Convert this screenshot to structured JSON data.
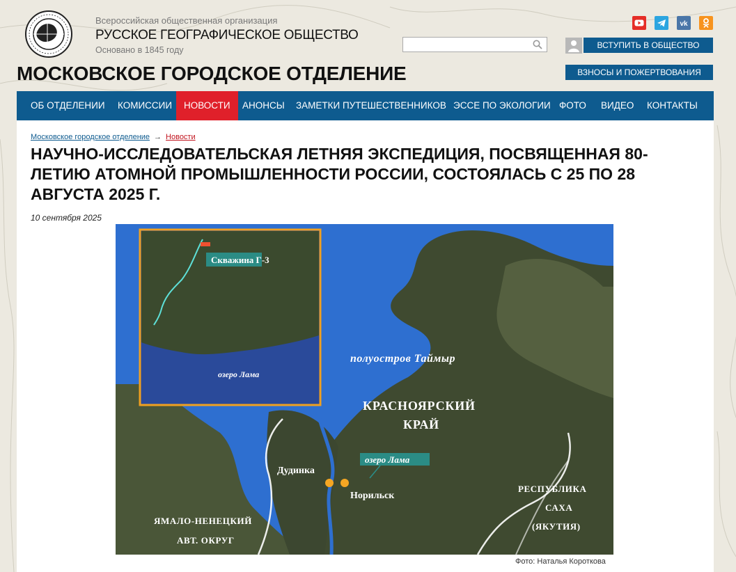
{
  "header": {
    "org_subtitle": "Всероссийская общественная организация",
    "org_name": "РУССКОЕ ГЕОГРАФИЧЕСКОЕ ОБЩЕСТВО",
    "org_founded": "Основано в 1845 году",
    "branch_title": "МОСКОВСКОЕ ГОРОДСКОЕ ОТДЕЛЕНИЕ",
    "logo_text": "РУССКОЕ ГЕОГРАФИЧЕСКОЕ ОБЩЕСТВО • ОСНОВАНО В 1845 Г.",
    "join_button": "ВСТУПИТЬ В ОБЩЕСТВО",
    "donate_button": "ВЗНОСЫ И ПОЖЕРТВОВАНИЯ",
    "search": {
      "value": "",
      "placeholder": ""
    },
    "social": [
      {
        "icon": "youtube-icon",
        "color": "#e52d27"
      },
      {
        "icon": "telegram-icon",
        "color": "#2ca5e0"
      },
      {
        "icon": "vk-icon",
        "color": "#4a76a8"
      },
      {
        "icon": "odnoklassniki-icon",
        "color": "#f7931e"
      }
    ]
  },
  "nav": {
    "items": [
      {
        "label": "ОБ ОТДЕЛЕНИИ",
        "active": false
      },
      {
        "label": "КОМИССИИ",
        "active": false
      },
      {
        "label": "НОВОСТИ",
        "active": true
      },
      {
        "label": "АНОНСЫ",
        "active": false
      },
      {
        "label": "ЗАМЕТКИ ПУТЕШЕСТВЕННИКОВ",
        "active": false
      },
      {
        "label": "ЭССЕ ПО ЭКОЛОГИИ",
        "active": false
      },
      {
        "label": "ФОТО",
        "active": false
      },
      {
        "label": "ВИДЕО",
        "active": false
      },
      {
        "label": "КОНТАКТЫ",
        "active": false
      }
    ]
  },
  "breadcrumb": {
    "home": "Московское городское отделение",
    "current": "Новости"
  },
  "article": {
    "title": "НАУЧНО-ИССЛЕДОВАТЕЛЬСКАЯ ЛЕТНЯЯ ЭКСПЕДИЦИЯ, ПОСВЯЩЕННАЯ 80-ЛЕТИЮ АТОМНОЙ ПРОМЫШЛЕННОСТИ РОССИИ, СОСТОЯЛАСЬ С 25 ПО 28 АВГУСТА 2025 Г.",
    "date": "10 сентября 2025",
    "photo_caption": "Фото: Наталья Короткова",
    "map_labels": {
      "well": "Скважина Г-3",
      "lake_inset": "озеро Лама",
      "peninsula": "полуостров Таймыр",
      "krai_line1": "КРАСНОЯРСКИЙ",
      "krai_line2": "КРАЙ",
      "lake_main": "озеро Лама",
      "dudinka": "Дудинка",
      "norilsk": "Норильск",
      "sakha_line1": "РЕСПУБЛИКА",
      "sakha_line2": "САХА",
      "sakha_line3": "(ЯКУТИЯ)",
      "yamal_line1": "ЯМАЛО-НЕНЕЦКИЙ",
      "yamal_line2": "АВТ. ОКРУГ"
    }
  },
  "colors": {
    "brand_blue": "#0e5b8f",
    "active_red": "#e0202a",
    "sea": "#2e6fd0",
    "land": "#3f4a30",
    "inset_border": "#f0a020",
    "label_teal": "#2a8f8a",
    "city_dot": "#f5a623"
  }
}
